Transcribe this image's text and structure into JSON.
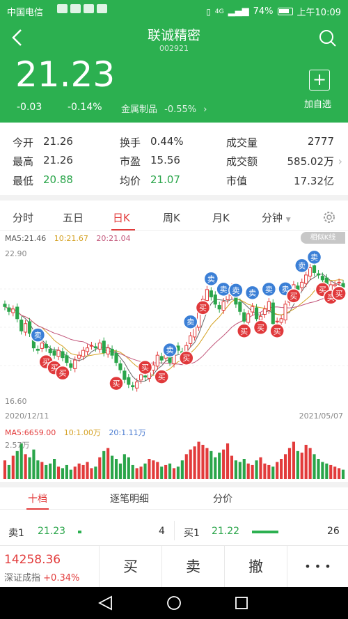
{
  "status_bar": {
    "carrier": "中国电信",
    "network": "4G",
    "battery": "74%",
    "time": "上午10:09"
  },
  "header": {
    "title": "联诚精密",
    "code": "002921",
    "price": "21.23",
    "change": "-0.03",
    "change_pct": "-0.14%",
    "sector_name": "金属制品",
    "sector_change": "-0.55%",
    "add_label": "加自选",
    "colors": {
      "brand_green": "#2cb050",
      "up_red": "#e23b3b",
      "down_green": "#2aa54a"
    }
  },
  "stats": {
    "open_label": "今开",
    "open": "21.26",
    "high_label": "最高",
    "high": "21.26",
    "low_label": "最低",
    "low": "20.88",
    "turnover_label": "换手",
    "turnover": "0.44%",
    "pe_label": "市盈",
    "pe": "15.56",
    "avg_label": "均价",
    "avg": "21.07",
    "volume_label": "成交量",
    "volume": "2777",
    "amount_label": "成交额",
    "amount": "585.02万",
    "mcap_label": "市值",
    "mcap": "17.32亿"
  },
  "chart_tabs": [
    "分时",
    "五日",
    "日K",
    "周K",
    "月K",
    "分钟"
  ],
  "chart_info": {
    "ma5": "MA5:21.46",
    "ma10": "10:21.67",
    "ma20": "20:21.04",
    "similar_k": "相似K线",
    "y_top": "22.90",
    "y_bottom": "16.60",
    "date_start": "2020/12/11",
    "date_end": "2021/05/07",
    "vol_ma5": "MA5:6659.00",
    "vol_ma10": "10:1.00万",
    "vol_ma20": "20:1.11万",
    "vol_max": "2.57万",
    "buy_marker": "买",
    "sell_marker": "卖"
  },
  "chart_data": {
    "type": "candlestick",
    "x_start": "2020/12/11",
    "x_end": "2021/05/07",
    "ylim": [
      16.6,
      22.9
    ],
    "close": [
      20.6,
      20.4,
      20.5,
      20.1,
      19.6,
      19.9,
      19.5,
      18.9,
      18.8,
      19.1,
      18.9,
      18.7,
      18.6,
      18.8,
      18.5,
      18.3,
      18.1,
      18.4,
      18.6,
      18.8,
      18.9,
      19.0,
      18.9,
      19.1,
      18.7,
      18.9,
      18.6,
      18.3,
      18.0,
      17.6,
      17.4,
      17.3,
      17.5,
      17.8,
      17.7,
      17.9,
      18.2,
      18.6,
      18.4,
      18.7,
      18.3,
      18.9,
      18.8,
      18.6,
      19.0,
      19.4,
      19.8,
      20.6,
      20.9,
      21.3,
      21.0,
      20.7,
      20.5,
      20.8,
      21.1,
      21.4,
      20.7,
      20.4,
      20.0,
      20.3,
      20.6,
      20.1,
      20.2,
      20.5,
      20.8,
      19.9,
      20.0,
      20.1,
      20.7,
      21.1,
      21.5,
      21.3,
      21.6,
      21.9,
      22.2,
      22.0,
      21.9,
      21.7,
      21.2,
      21.5,
      21.5,
      21.6,
      21.4
    ],
    "volume": [
      1.2,
      0.9,
      1.5,
      1.8,
      2.3,
      1.6,
      1.4,
      1.9,
      1.2,
      1.1,
      0.9,
      1.0,
      1.3,
      0.8,
      0.7,
      0.9,
      0.6,
      0.8,
      1.0,
      0.9,
      1.1,
      0.7,
      0.8,
      1.4,
      1.8,
      2.0,
      1.5,
      1.3,
      1.0,
      1.6,
      1.4,
      0.9,
      0.7,
      0.8,
      1.0,
      1.3,
      1.2,
      1.1,
      0.8,
      0.9,
      1.0,
      0.7,
      0.8,
      1.2,
      1.6,
      1.9,
      2.1,
      2.4,
      2.2,
      2.0,
      1.8,
      1.4,
      1.7,
      1.9,
      2.3,
      1.5,
      1.2,
      1.1,
      1.3,
      1.0,
      0.9,
      1.2,
      1.4,
      1.0,
      0.9,
      0.8,
      1.1,
      1.3,
      1.6,
      2.0,
      2.4,
      1.8,
      1.7,
      2.2,
      2.0,
      1.6,
      1.3,
      1.1,
      1.0,
      0.9,
      0.8,
      0.7,
      0.6
    ]
  },
  "bottom_tabs": [
    "十档",
    "逐笔明细",
    "分价"
  ],
  "orderbook": {
    "sell1_label": "卖1",
    "sell1_price": "21.23",
    "sell1_qty": "4",
    "buy1_label": "买1",
    "buy1_price": "21.22",
    "buy1_qty": "26"
  },
  "footer": {
    "index_value": "14258.36",
    "index_name": "深证成指",
    "index_change": "+0.34%",
    "buy": "买",
    "sell": "卖",
    "cancel": "撤",
    "more": "• • •"
  }
}
